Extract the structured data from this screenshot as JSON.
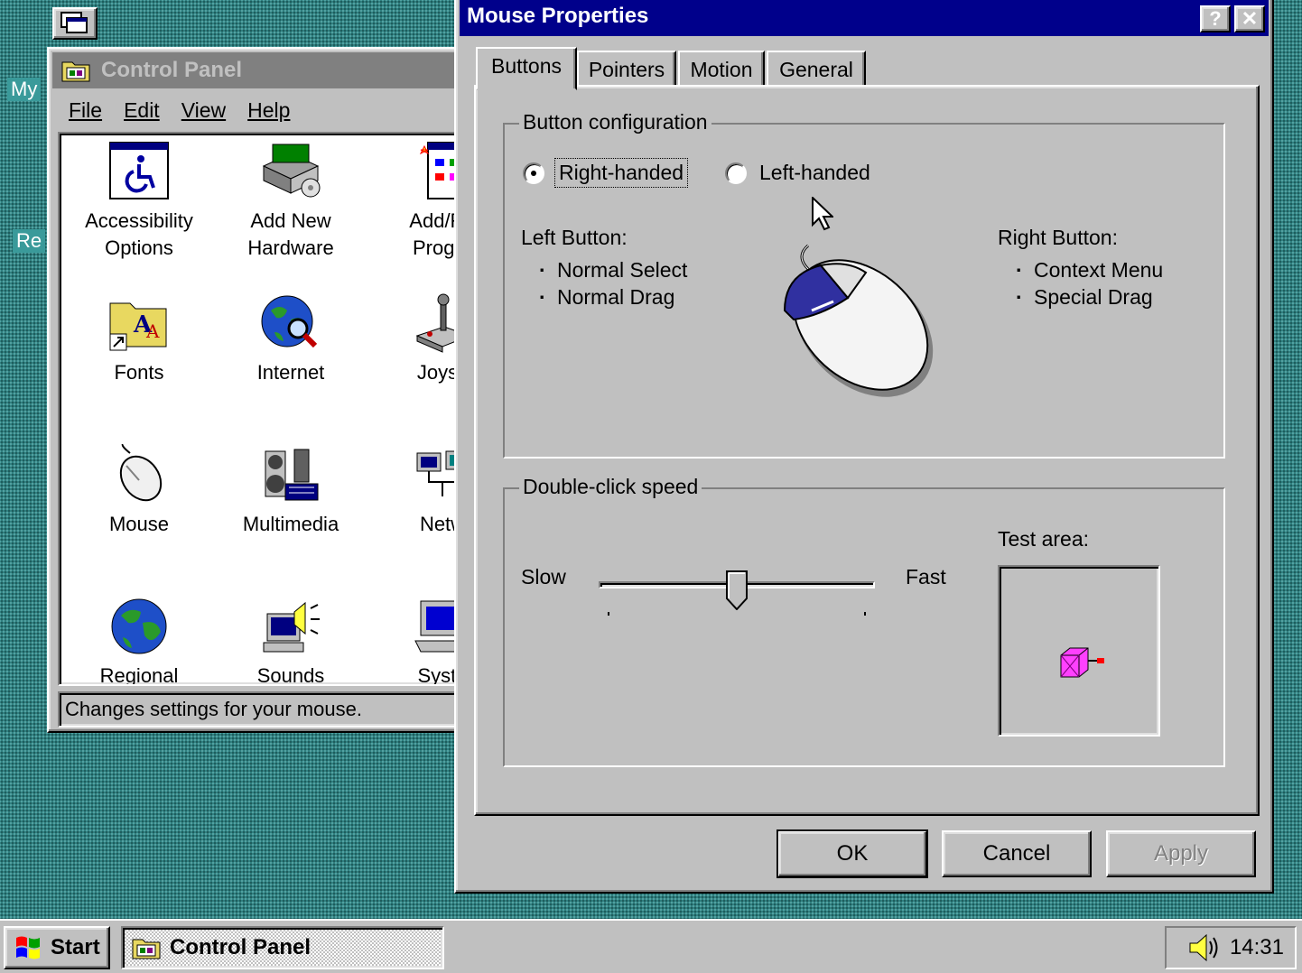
{
  "desktop": {
    "icons": [
      {
        "label": "My"
      },
      {
        "label": "Re"
      }
    ]
  },
  "control_panel": {
    "title": "Control Panel",
    "menu": [
      "File",
      "Edit",
      "View",
      "Help"
    ],
    "items": [
      {
        "line1": "Accessibility",
        "line2": "Options",
        "icon": "accessibility-icon"
      },
      {
        "line1": "Add New",
        "line2": "Hardware",
        "icon": "hardware-icon"
      },
      {
        "line1": "Add/Re",
        "line2": "Progra",
        "icon": "add-remove-programs-icon"
      },
      {
        "line1": "Fonts",
        "line2": "",
        "icon": "fonts-folder-icon"
      },
      {
        "line1": "Internet",
        "line2": "",
        "icon": "internet-globe-icon"
      },
      {
        "line1": "Joysti",
        "line2": "",
        "icon": "joystick-icon"
      },
      {
        "line1": "Mouse",
        "line2": "",
        "icon": "mouse-icon"
      },
      {
        "line1": "Multimedia",
        "line2": "",
        "icon": "multimedia-icon"
      },
      {
        "line1": "Netw",
        "line2": "",
        "icon": "network-icon"
      },
      {
        "line1": "Regional",
        "line2": "",
        "icon": "globe-icon"
      },
      {
        "line1": "Sounds",
        "line2": "",
        "icon": "sounds-icon"
      },
      {
        "line1": "Syste",
        "line2": "",
        "icon": "computer-icon"
      }
    ],
    "status": "Changes settings for your mouse."
  },
  "mouse_props": {
    "title": "Mouse Properties",
    "help_btn": "?",
    "close_btn": "✕",
    "tabs": [
      "Buttons",
      "Pointers",
      "Motion",
      "General"
    ],
    "active_tab": "Buttons",
    "button_config": {
      "label": "Button configuration",
      "right_handed": "Right-handed",
      "left_handed": "Left-handed",
      "selected": "Right-handed"
    },
    "left_button": {
      "title": "Left Button:",
      "items": [
        "Normal Select",
        "Normal Drag"
      ]
    },
    "right_button": {
      "title": "Right Button:",
      "items": [
        "Context Menu",
        "Special Drag"
      ]
    },
    "double_click": {
      "label": "Double-click speed",
      "slow": "Slow",
      "fast": "Fast",
      "position_fraction": 0.5,
      "test_area_label": "Test area:"
    },
    "buttons": {
      "ok": "OK",
      "cancel": "Cancel",
      "apply": "Apply"
    }
  },
  "taskbar": {
    "start": "Start",
    "task": "Control Panel",
    "clock": "14:31"
  }
}
